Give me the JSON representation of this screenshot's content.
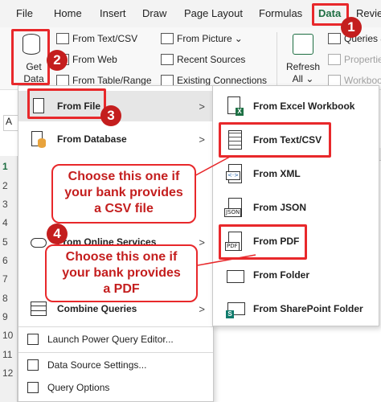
{
  "tabs": [
    "File",
    "Home",
    "Insert",
    "Draw",
    "Page Layout",
    "Formulas",
    "Data",
    "Revie"
  ],
  "active_tab": "Data",
  "ribbon": {
    "get_data_label": [
      "Get",
      "Data"
    ],
    "get_data_arrow": "⌄",
    "from_text_csv": "From Text/CSV",
    "from_web": "From Web",
    "from_table_range": "From Table/Range",
    "from_picture": "From Picture",
    "from_picture_arrow": "⌄",
    "recent_sources": "Recent Sources",
    "existing_connections": "Existing Connections",
    "refresh_label": [
      "Refresh",
      "All"
    ],
    "refresh_arrow": "⌄",
    "queries": "Queries &",
    "properties": "Properties",
    "workbook": "Workboo"
  },
  "namebox": "A",
  "row_numbers": [
    "1",
    "2",
    "3",
    "4",
    "5",
    "6",
    "7",
    "8",
    "9",
    "10",
    "11",
    "12"
  ],
  "menu": {
    "items": [
      {
        "label": "From File",
        "arrow": ">"
      },
      {
        "label": "From Database",
        "arrow": ">"
      },
      {
        "label": "From Online Services",
        "arrow": ">"
      },
      {
        "label": "Combine Queries",
        "arrow": ">"
      }
    ],
    "small_items": [
      "Launch Power Query Editor...",
      "Data Source Settings...",
      "Query Options"
    ]
  },
  "submenu": {
    "items": [
      "From Excel Workbook",
      "From Text/CSV",
      "From XML",
      "From JSON",
      "From PDF",
      "From Folder",
      "From SharePoint Folder"
    ],
    "icon_tags": {
      "xml": "<·>",
      "json": "JSON",
      "pdf": "PDF",
      "excel": "X",
      "sharepoint": "S"
    }
  },
  "annotations": {
    "steps": [
      "1",
      "2",
      "3",
      "4"
    ],
    "callout_csv": [
      "Choose this one if",
      "your bank provides",
      "a CSV file"
    ],
    "callout_pdf": [
      "Choose this one if",
      "your bank provides",
      "a PDF"
    ],
    "color": "#e8282b"
  }
}
